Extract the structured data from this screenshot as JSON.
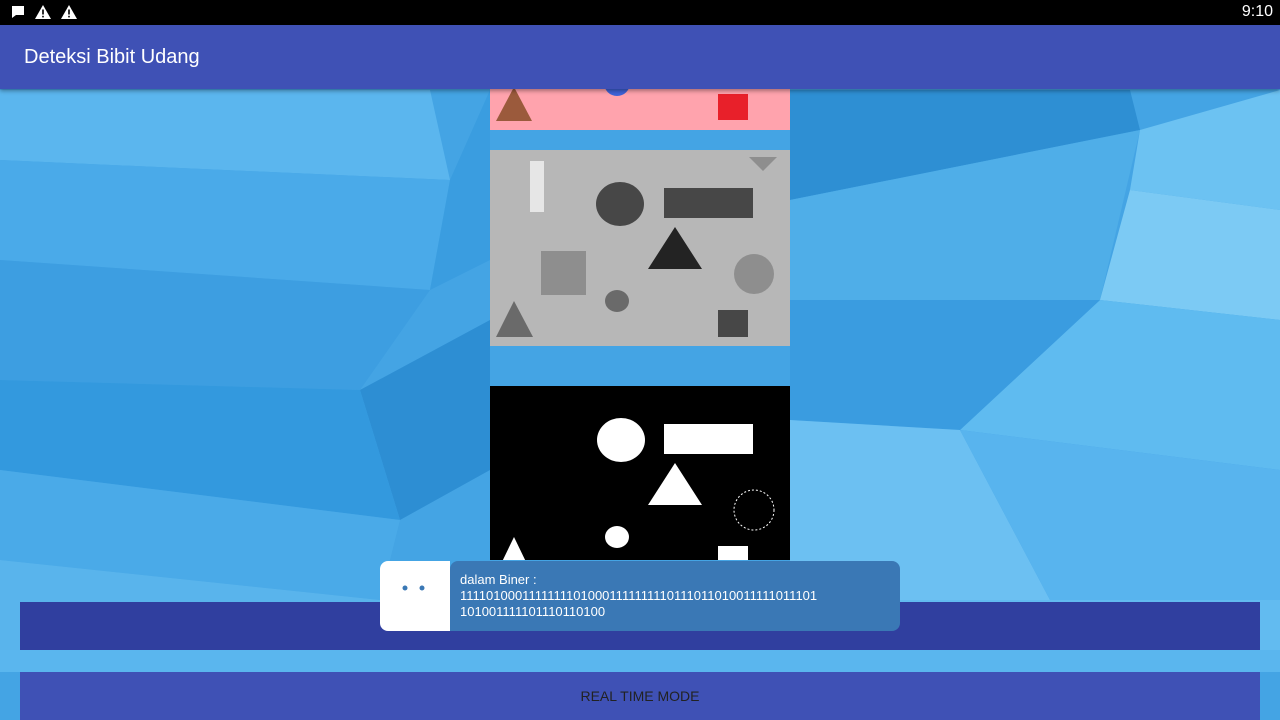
{
  "status_bar": {
    "time": "9:10",
    "icons": [
      "chat-notification-icon",
      "warning-icon",
      "warning-icon"
    ]
  },
  "app_bar": {
    "title": "Deteksi Bibit Udang"
  },
  "images": {
    "color": "color-shapes-image",
    "grayscale": "grayscale-shapes-image",
    "binary": "binary-shapes-image"
  },
  "toast": {
    "line1": "dalam Biner :",
    "line2": "11110100011111111010001111111110111011010011111011101",
    "line3": "101001111101110110100"
  },
  "buttons": {
    "real_time_mode": "REAL TIME MODE"
  },
  "colors": {
    "primary": "#3f51b5",
    "primary_dark": "#303f9f",
    "toast_bg": "#3a78b5"
  }
}
